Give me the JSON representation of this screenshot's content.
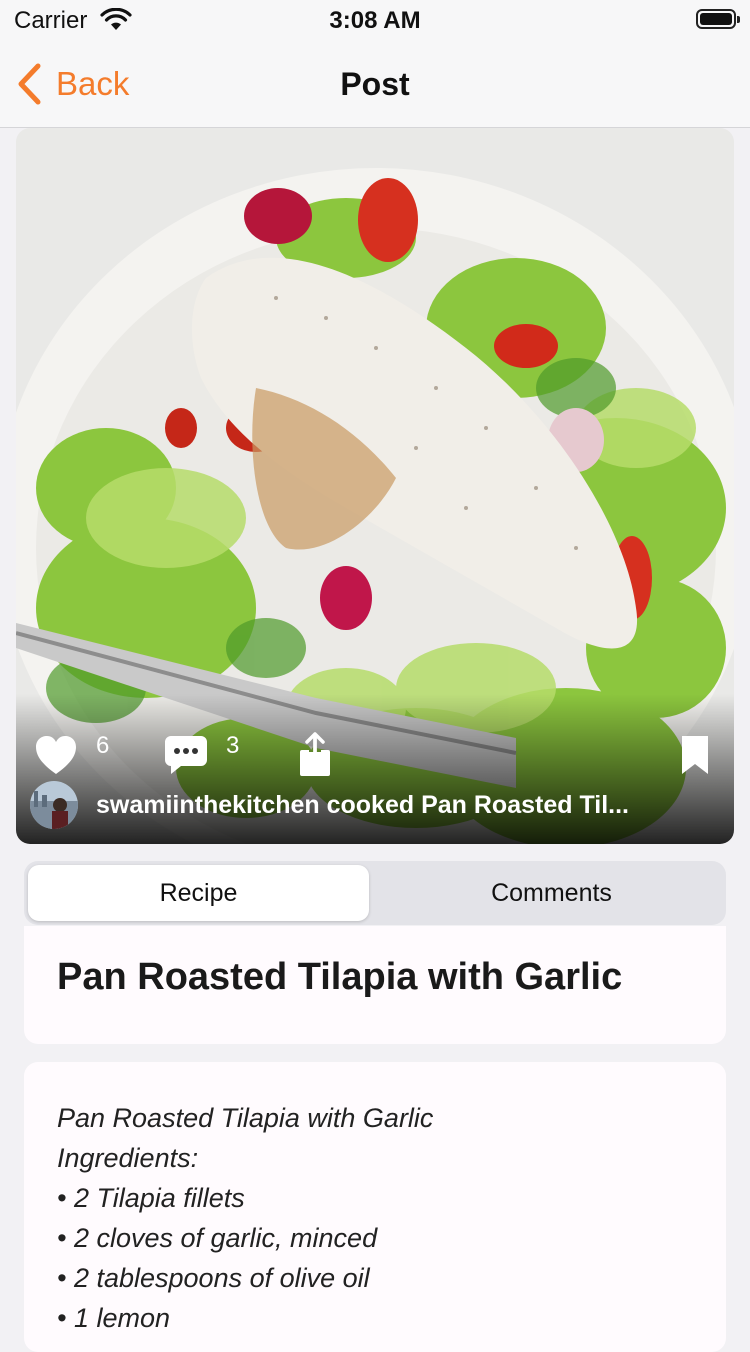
{
  "status_bar": {
    "carrier": "Carrier",
    "time": "3:08 AM"
  },
  "nav": {
    "back_label": "Back",
    "title": "Post",
    "accent_color": "#f47c2c"
  },
  "post": {
    "likes": "6",
    "comments": "3",
    "caption": "swamiinthekitchen cooked Pan Roasted Til..."
  },
  "tabs": {
    "recipe": "Recipe",
    "comments": "Comments",
    "selected": "Recipe"
  },
  "recipe": {
    "title": "Pan Roasted Tilapia with Garlic",
    "lines": [
      "Pan Roasted Tilapia with Garlic",
      "Ingredients:",
      "• 2 Tilapia fillets",
      "• 2 cloves of garlic, minced",
      "• 2 tablespoons of olive oil",
      "• 1 lemon"
    ]
  },
  "icons": {
    "back": "chevron-left-icon",
    "like": "heart-icon",
    "comment": "speech-bubble-icon",
    "share": "share-icon",
    "bookmark": "bookmark-icon",
    "wifi": "wifi-icon",
    "battery": "battery-icon"
  }
}
